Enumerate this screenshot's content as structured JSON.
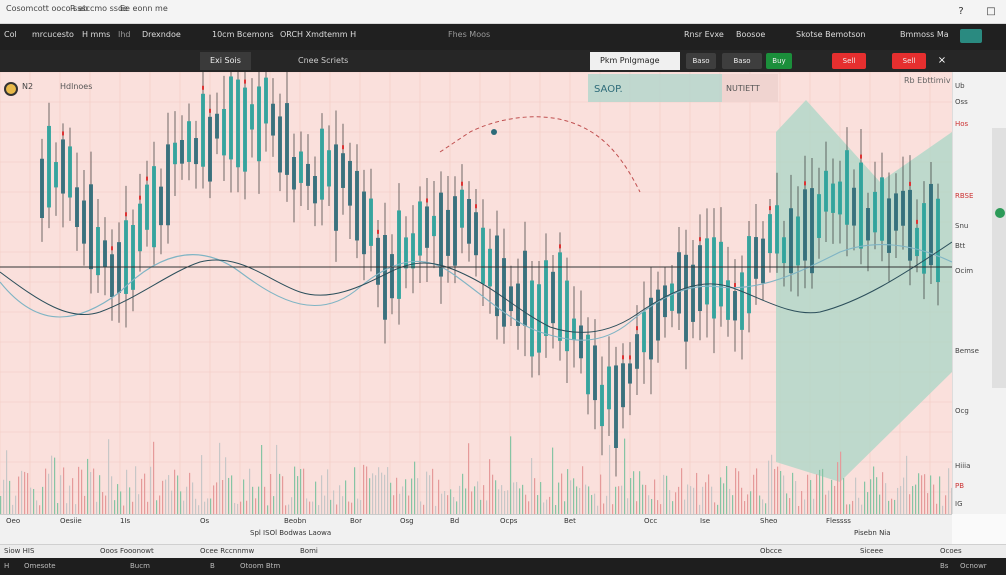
{
  "window": {
    "title": "Cosomcott ooco sssccmo ssoe",
    "tab_a": "R ab",
    "tab_b": "Ee eonn me",
    "minimize": "?",
    "maximize": "□",
    "close": "×"
  },
  "toolbar": {
    "items": [
      "Col",
      "mrcucesto",
      "H mms",
      "Ihd",
      "Drexndoe",
      "10cm Bcemons",
      "ORCH Xmdtemm H",
      "Fhes Moos"
    ],
    "right_items": [
      "Rnsr Evxe",
      "Boosoe",
      "Skotse Bemotson",
      "Bmmoss Ma"
    ]
  },
  "toolbar2": {
    "tab_active": "Exi Sois",
    "tab_second": "Cnee Scriets",
    "price_box": "Pkm Pnlgmage",
    "button_a": "Baso",
    "button_b": "Baso",
    "buy_label": "Buy",
    "sell_label": "Sell",
    "sell_label_b": "Sell",
    "close_glyph": "×"
  },
  "chart": {
    "symbol": "N2",
    "symbol_name": "Hdlnoes",
    "badge_a": "SAOP.",
    "badge_b": "NUTIETT",
    "annotation_right": "Rb Ebttimiv",
    "bg_color": "#fae0dc",
    "zone_color": "#a9d7c7",
    "bull_color": "#2aa39c",
    "bear_color": "#2d6b79"
  },
  "right_panel": {
    "labels": [
      "Ub",
      "Oss",
      "Hos",
      "RBSE",
      "Snu",
      "Btt",
      "Ocim",
      "Bemse",
      "Ocg",
      "Hiiia",
      "PB",
      "IG"
    ]
  },
  "bottom_axis": {
    "labels": [
      "Oeo",
      "Oesiie",
      "1Is",
      "Os",
      "Beobn",
      "Bor",
      "Osg",
      "Bd",
      "Ocps",
      "Bet",
      "Occ",
      "Ise",
      "Sheo",
      "Flessss"
    ],
    "sub_label": "Spl ISOl Bodwas Laowa",
    "sub_label_b": "Pisebn Nia"
  },
  "statusbar": {
    "left": "Siow HIS",
    "items": [
      "Ooos Fooonowt",
      "Ocee Rccnnmw",
      "Bomi",
      "Obcce",
      "Siceee",
      "Ocoes"
    ]
  },
  "footer": {
    "items": [
      "H",
      "Omesote",
      "Bucm",
      "B",
      "Otoom Btm",
      "Bs",
      "Ocnowr"
    ]
  }
}
